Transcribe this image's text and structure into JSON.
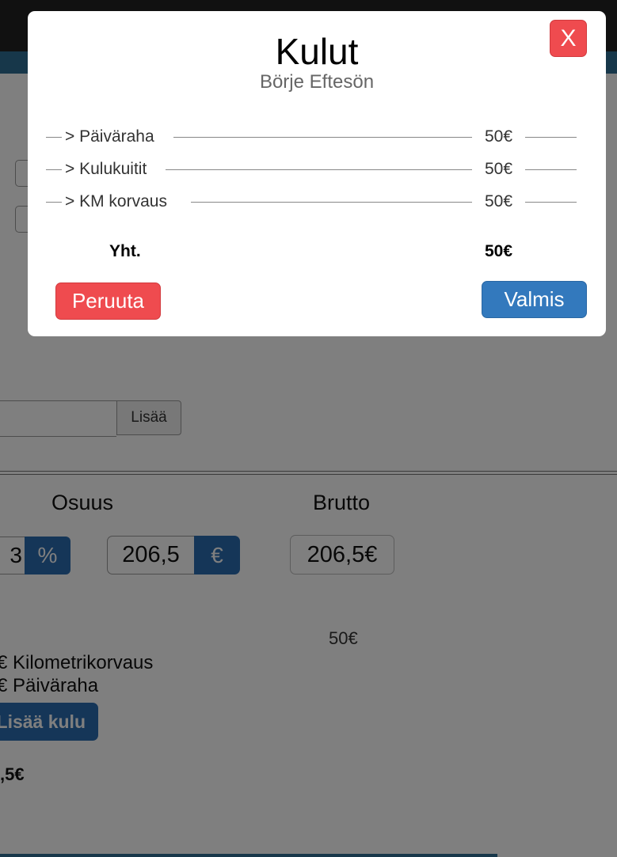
{
  "background": {
    "add_button_label": "Lisää",
    "columns": {
      "share_header": "Osuus",
      "gross_header": "Brutto"
    },
    "percent_value": "3",
    "percent_button": "%",
    "amount_value": "206,5",
    "euro_button": "€",
    "gross_value": "206,5€",
    "expense_amount": "50€",
    "expense_lines": [
      "€ Kilometrikorvaus",
      "€ Päiväraha"
    ],
    "add_expense_button": "Lisää kulu",
    "total_partial": ",5€"
  },
  "modal": {
    "title": "Kulut",
    "subtitle": "Börje Eftesön",
    "close_label": "X",
    "rows": [
      {
        "label": ">  Päiväraha",
        "amount": "50€"
      },
      {
        "label": "> Kulukuitit",
        "amount": "50€"
      },
      {
        "label": ">  KM korvaus",
        "amount": "50€"
      }
    ],
    "total_label": "Yht.",
    "total_amount": "50€",
    "cancel_label": "Peruuta",
    "done_label": "Valmis"
  },
  "colors": {
    "danger": "#ef4b4f",
    "primary": "#3379bd",
    "overlay": "rgba(0,0,0,0.5)"
  }
}
